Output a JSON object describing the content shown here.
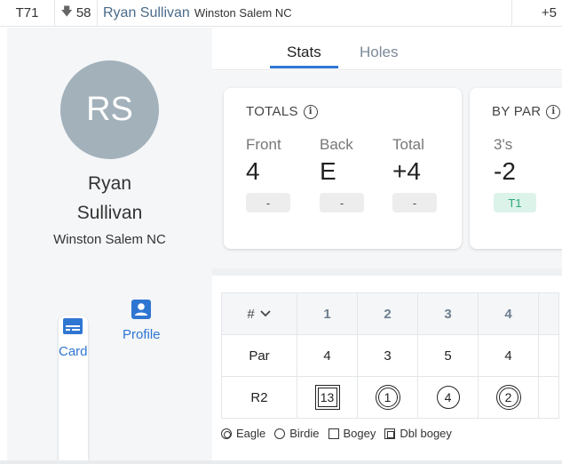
{
  "top_row": {
    "position": "T71",
    "movement_arrow": "down-arrow-icon",
    "movement": "58",
    "player_name": "Ryan Sullivan",
    "player_location": "Winston Salem NC",
    "score": "+5"
  },
  "profile": {
    "initials": "RS",
    "name_line1": "Ryan",
    "name_line2": "Sullivan",
    "location": "Winston Salem NC",
    "actions": [
      {
        "label": "Card",
        "icon": "card-icon"
      },
      {
        "label": "Profile",
        "icon": "profile-icon"
      }
    ]
  },
  "tabs": [
    {
      "label": "Stats",
      "active": true
    },
    {
      "label": "Holes",
      "active": false
    }
  ],
  "totals_card": {
    "title": "TOTALS",
    "stats": [
      {
        "label": "Front",
        "value": "4",
        "chip": "-"
      },
      {
        "label": "Back",
        "value": "E",
        "chip": "-"
      },
      {
        "label": "Total",
        "value": "+4",
        "chip": "-"
      }
    ]
  },
  "bypar_card": {
    "title": "BY PAR",
    "stats": [
      {
        "label": "3's",
        "value": "-2",
        "chip": "T1"
      }
    ]
  },
  "scorecard": {
    "hole_header": "#",
    "holes": [
      "1",
      "2",
      "3",
      "4"
    ],
    "par_label": "Par",
    "par": [
      "4",
      "3",
      "5",
      "4"
    ],
    "round_label": "R2",
    "round_scores": [
      "13",
      "1",
      "4",
      "2"
    ],
    "round_marks": [
      "dbl-bogey",
      "eagle",
      "par-circle",
      "eagle"
    ]
  },
  "legend": [
    {
      "label": "Eagle"
    },
    {
      "label": "Birdie"
    },
    {
      "label": "Bogey"
    },
    {
      "label": "Dbl bogey"
    }
  ],
  "colors": {
    "accent": "#2f76d2",
    "avatar_bg": "#a3b1bb",
    "green_chip_bg": "#dcf3ea",
    "green_chip_text": "#2ca57a"
  }
}
